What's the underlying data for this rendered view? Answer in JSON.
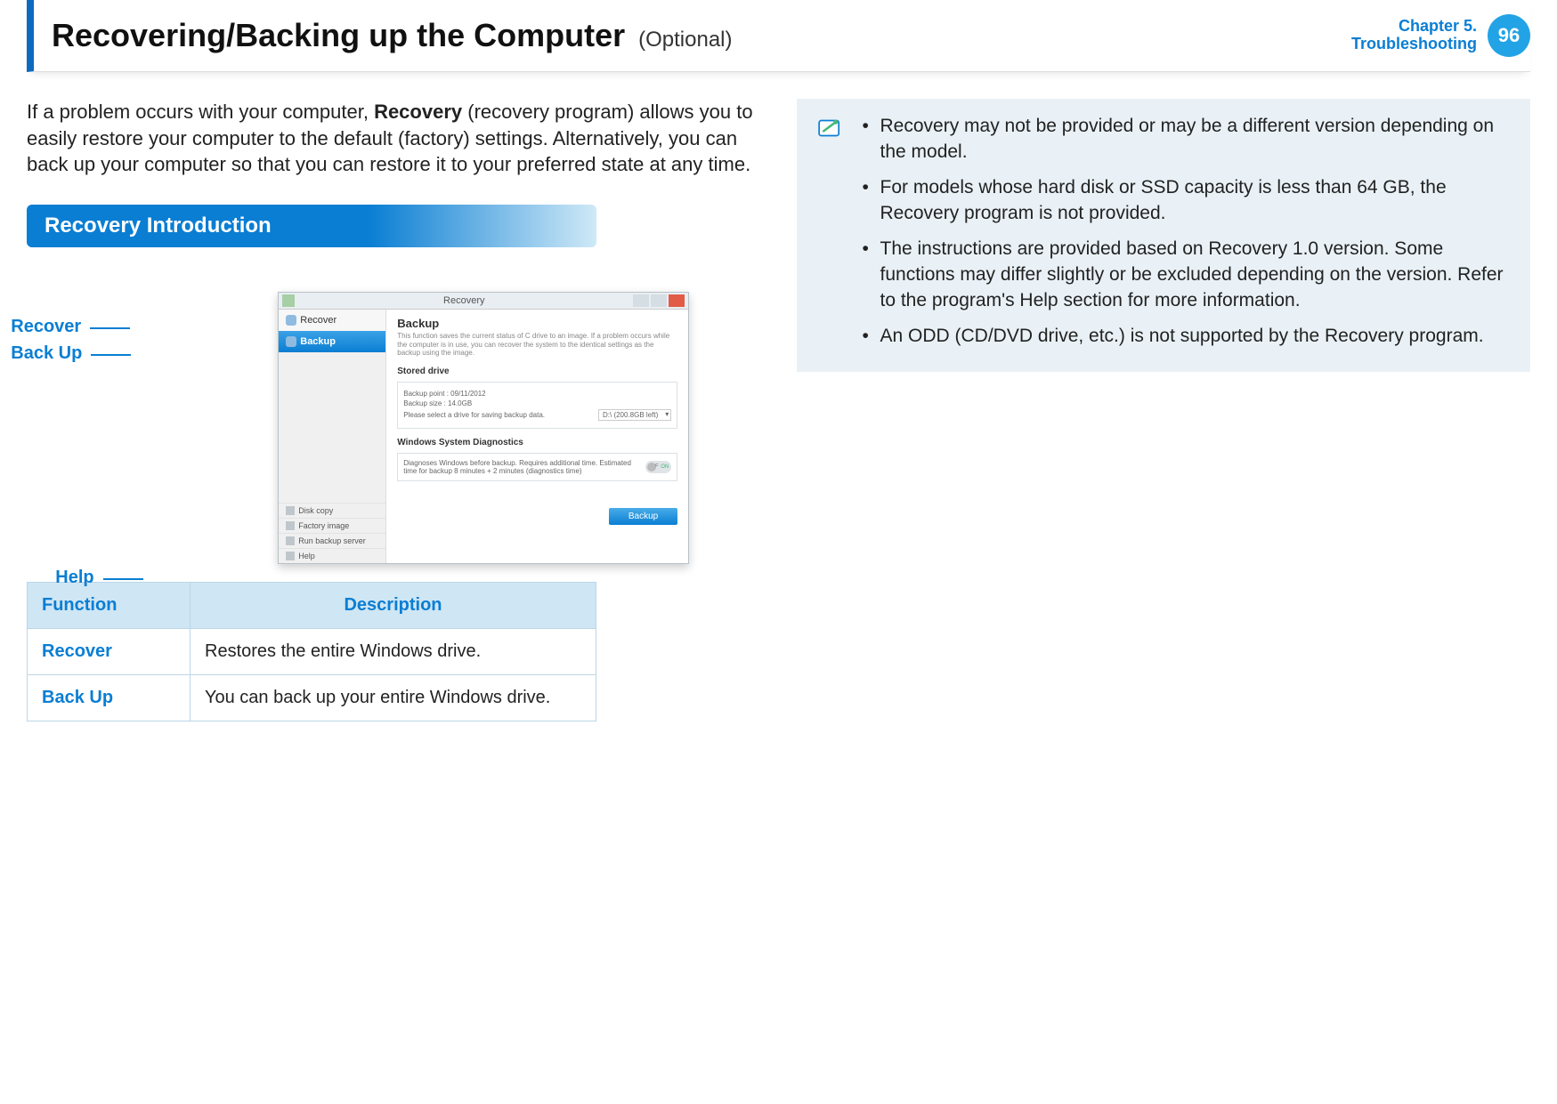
{
  "header": {
    "title": "Recovering/Backing up the Computer",
    "subtitle": "(Optional)",
    "chapter_line1": "Chapter 5.",
    "chapter_line2": "Troubleshooting",
    "page_number": "96"
  },
  "intro": {
    "pre": "If a problem occurs with your computer, ",
    "strong": "Recovery",
    "post": " (recovery program) allows you to easily restore your computer to the default (factory) settings. Alternatively, you can back up your computer so that you can restore it to your preferred state at any time."
  },
  "section_heading": "Recovery Introduction",
  "callouts": {
    "recover": "Recover",
    "backup": "Back Up",
    "help": "Help"
  },
  "screenshot": {
    "window_title": "Recovery",
    "recover_item": "Recover",
    "backup_item": "Backup",
    "disk_copy": "Disk copy",
    "factory_image": "Factory image",
    "run_backup_server": "Run backup server",
    "help_item": "Help",
    "panel_heading": "Backup",
    "panel_desc": "This function saves the current status of C drive to an image.\nIf a problem occurs while the computer is in use, you can recover the system to the identical settings as the backup using the image.",
    "stored_drive_label": "Stored drive",
    "backup_point": "Backup point : 09/11/2012",
    "backup_size": "Backup size : 14.0GB",
    "select_drive_prompt": "Please select a drive for saving backup data.",
    "drive_option": "D:\\ (200.8GB left)",
    "diagnostics_label": "Windows System Diagnostics",
    "diagnostics_desc": "Diagnoses Windows before backup. Requires additional time.\nEstimated time for backup 8 minutes + 2 minutes (diagnostics time)",
    "toggle_off": "OFF",
    "toggle_on": "ON",
    "backup_button": "Backup"
  },
  "table": {
    "head_function": "Function",
    "head_description": "Description",
    "rows": [
      {
        "fn": "Recover",
        "desc": "Restores the entire Windows drive."
      },
      {
        "fn": "Back Up",
        "desc": "You can back up your entire Windows drive."
      }
    ]
  },
  "notes": [
    "Recovery may not be provided or may be a different version depending on the model.",
    "For models whose hard disk or SSD capacity is less than 64 GB, the Recovery program is not provided.",
    "The instructions are provided based on Recovery 1.0 version. Some functions may differ slightly or be excluded depending on the version. Refer to the program's Help section for more information.",
    "An ODD (CD/DVD drive, etc.) is not supported by the Recovery program."
  ]
}
